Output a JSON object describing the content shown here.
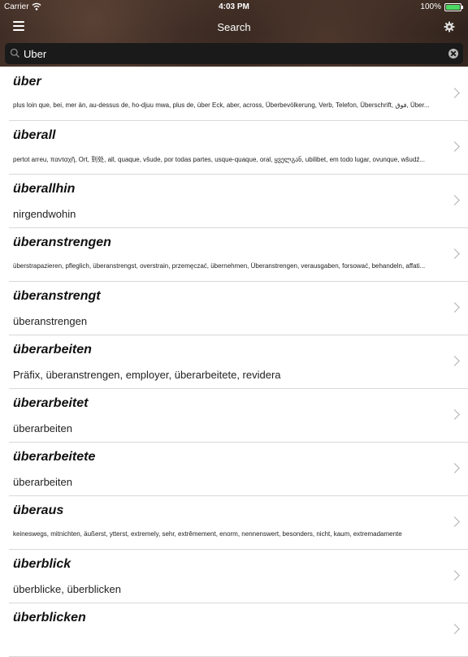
{
  "status": {
    "carrier": "Carrier",
    "time": "4:03 PM",
    "battery": "100%"
  },
  "header": {
    "title": "Search"
  },
  "search": {
    "value": "Uber"
  },
  "results": [
    {
      "word": "über",
      "definition": "plus loin que, bei, mer än, au-dessus de, ho-djuu mwa, plus de, über Eck, aber, across, Überbevölkerung, Verb, Telefon, Überschrift, فوق, Über..."
    },
    {
      "word": "überall",
      "definition": "pertot arreu, πανταχῆ, Ort, 到处, all, quaque, všude, por todas partes, usque-quaque, oral, ყველგან, ubilibet, em todo lugar, ovunque, wšudź..."
    },
    {
      "word": "überallhin",
      "definition": "nirgendwohin"
    },
    {
      "word": "überanstrengen",
      "definition": "überstrapazieren, pfleglich, überanstrengst, overstrain, przemęczać, übernehmen, Überanstrengen, verausgaben, forsować, behandeln, affati..."
    },
    {
      "word": "überanstrengt",
      "definition": "überanstrengen"
    },
    {
      "word": "überarbeiten",
      "definition": "Präfix, überanstrengen, employer, überarbeitete, revidera"
    },
    {
      "word": "überarbeitet",
      "definition": "überarbeiten"
    },
    {
      "word": "überarbeitete",
      "definition": "überarbeiten"
    },
    {
      "word": "überaus",
      "definition": "keineswegs, mitnichten, äußerst, ytterst, extremely, sehr, extrêmement, enorm, nennenswert, besonders, nicht, kaum, extremadamente"
    },
    {
      "word": "überblick",
      "definition": "überblicke, überblicken"
    },
    {
      "word": "überblicken",
      "definition": ""
    }
  ]
}
